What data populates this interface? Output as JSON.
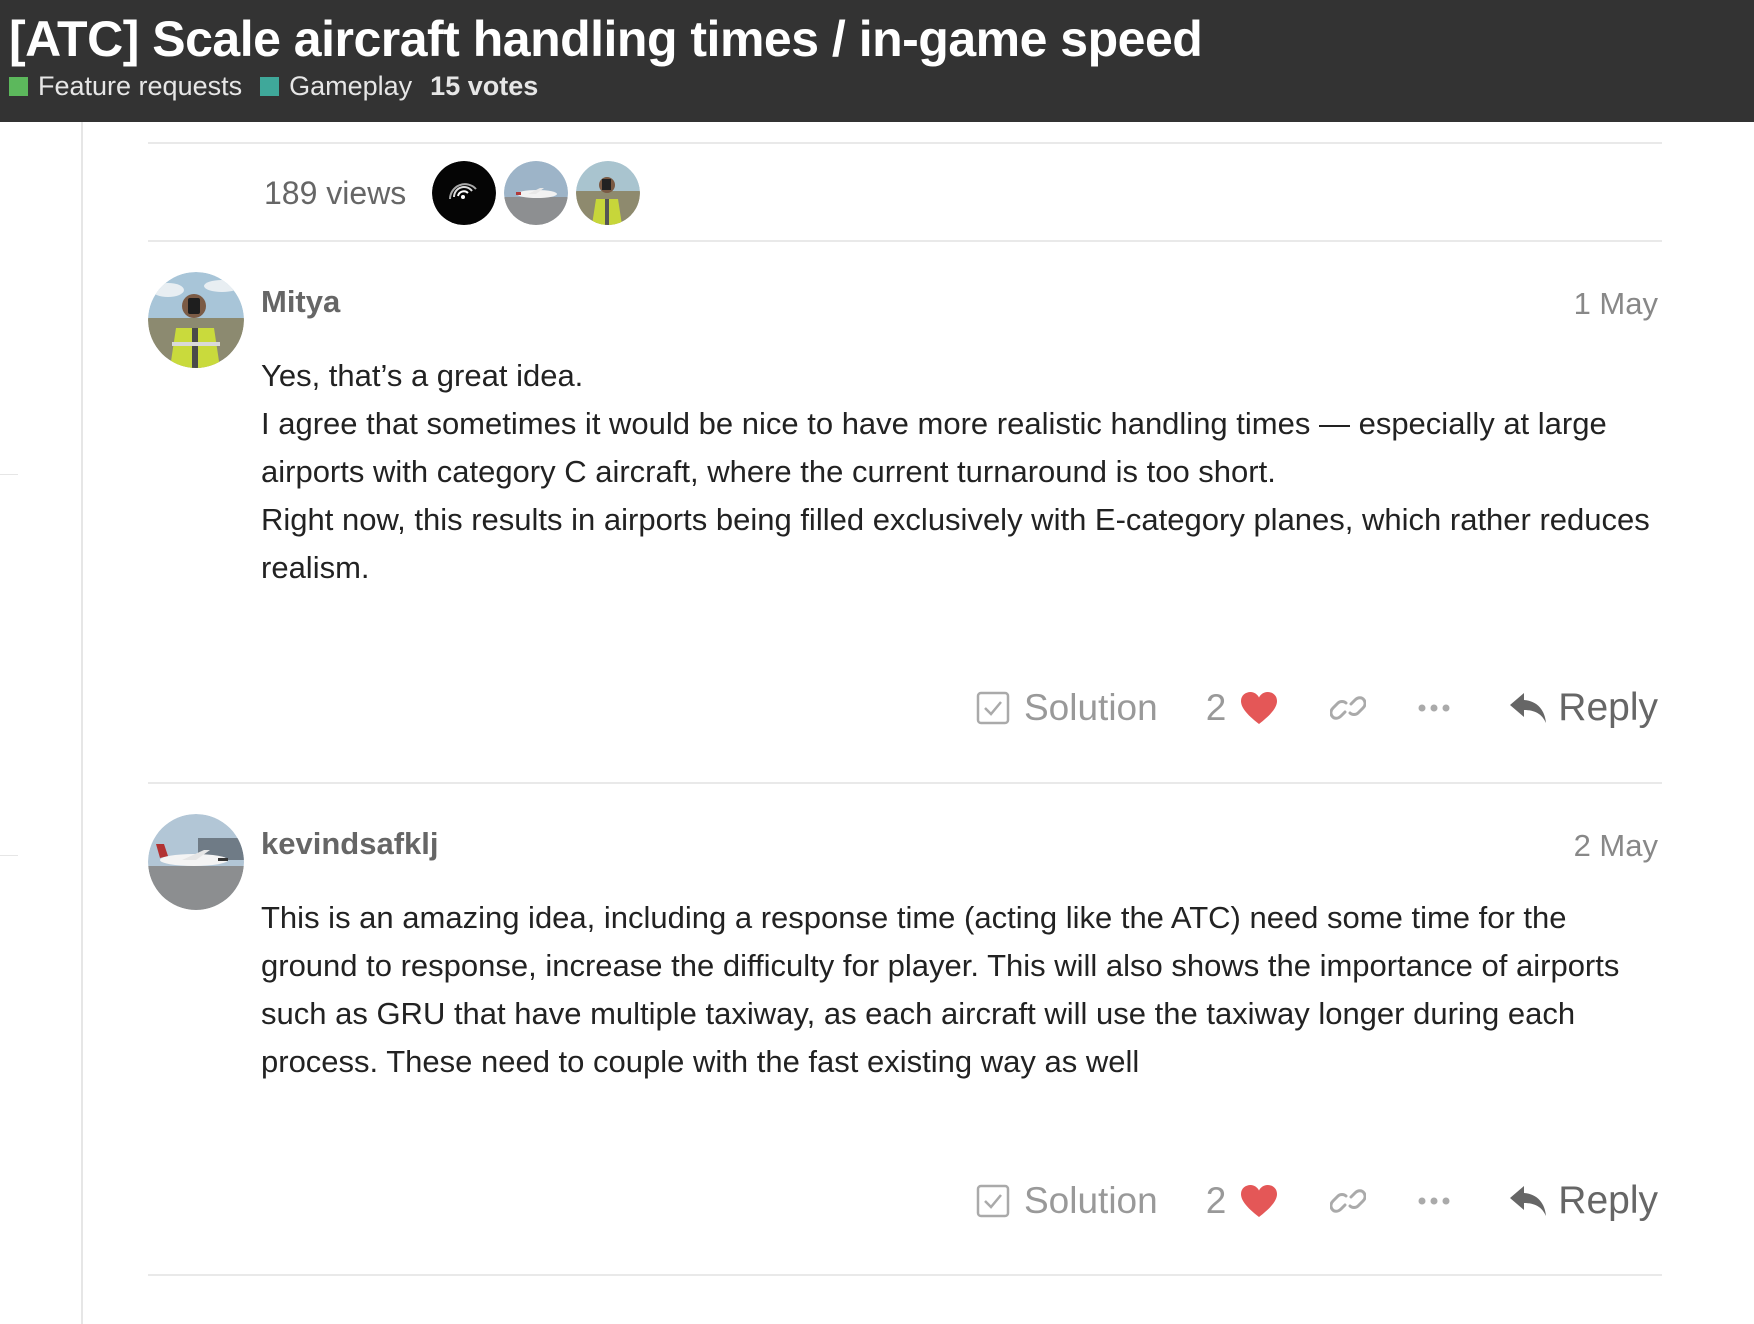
{
  "header": {
    "title": "[ATC] Scale aircraft handling times / in-game speed",
    "categories": [
      {
        "label": "Feature requests",
        "color": "#5cb85c"
      },
      {
        "label": "Gameplay",
        "color": "#3fa89a"
      }
    ],
    "votes": "15 votes"
  },
  "stats": {
    "views": "189 views",
    "participants": [
      "dark-radar-avatar",
      "airplane-avatar",
      "selfie-avatar"
    ]
  },
  "posts": [
    {
      "username": "Mitya",
      "date": "1 May",
      "avatar_icon": "selfie-avatar",
      "paragraphs": [
        "Yes, that’s a great idea.",
        "I agree that sometimes it would be nice to have more realistic handling times — especially at large airports with category C aircraft, where the current turnaround is too short.",
        "Right now, this results in airports being filled exclusively with E-category planes, which rather reduces realism."
      ],
      "actions": {
        "solution": "Solution",
        "likes": "2",
        "reply": "Reply"
      }
    },
    {
      "username": "kevindsafklj",
      "date": "2 May",
      "avatar_icon": "airplane-avatar",
      "paragraphs": [
        "This is an amazing idea, including a response time (acting like the ATC) need some time for the ground to response, increase the difficulty for player. This will also shows the importance of airports such as GRU that have multiple taxiway, as each aircraft will use the taxiway longer during each process. These need to couple with the fast existing way as well"
      ],
      "actions": {
        "solution": "Solution",
        "likes": "2",
        "reply": "Reply"
      }
    }
  ],
  "colors": {
    "header_bg": "#333333",
    "heart": "#e45757",
    "muted": "#999999"
  }
}
